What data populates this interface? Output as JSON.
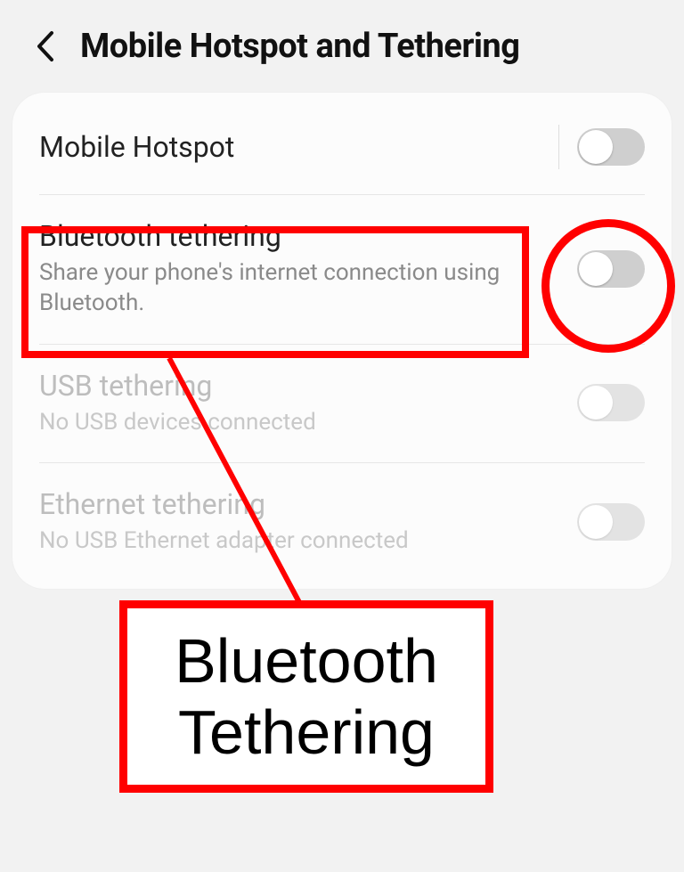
{
  "header": {
    "title": "Mobile Hotspot and Tethering"
  },
  "rows": {
    "hotspot": {
      "title": "Mobile Hotspot"
    },
    "bluetooth": {
      "title": "Bluetooth tethering",
      "sub": "Share your phone's internet connection using Bluetooth."
    },
    "usb": {
      "title": "USB tethering",
      "sub": "No USB devices connected"
    },
    "ethernet": {
      "title": "Ethernet tethering",
      "sub": "No USB Ethernet adapter connected"
    }
  },
  "annotation": {
    "label": "Bluetooth Tethering"
  }
}
